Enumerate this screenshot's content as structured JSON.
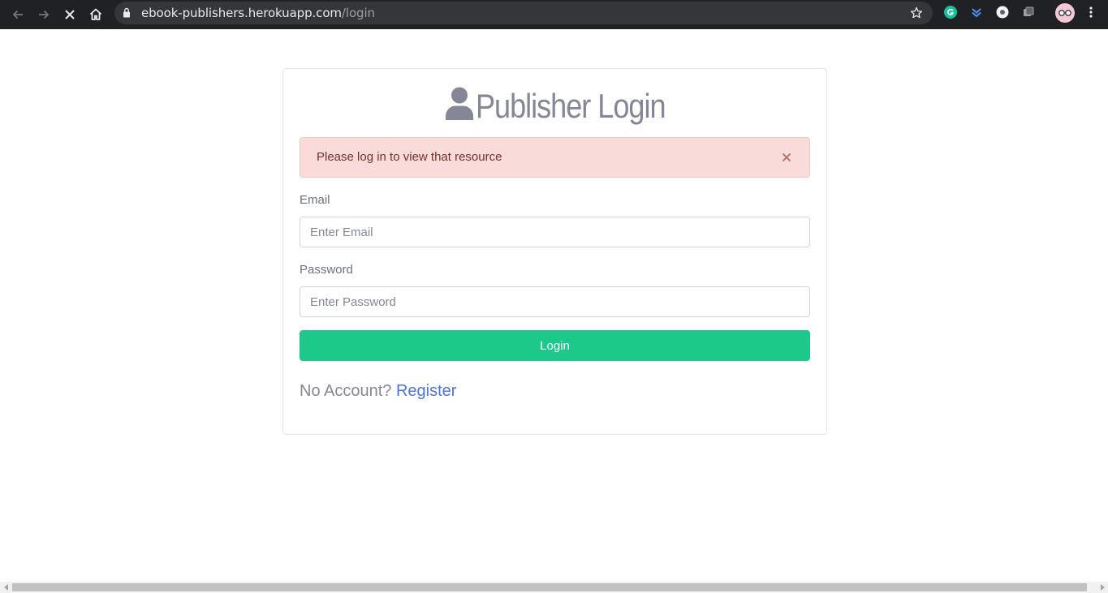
{
  "browser": {
    "url_host": "ebook-publishers.herokuapp.com",
    "url_path": "/login",
    "icons": {
      "back": "arrow-left-icon",
      "forward": "arrow-right-icon",
      "stop": "close-x-icon",
      "home": "home-icon",
      "lock": "lock-icon",
      "bookmark": "star-icon",
      "extensions": [
        "grammarly-icon",
        "pocket-icon",
        "lens-icon",
        "puzzle-icon"
      ],
      "profile": "avatar-icon",
      "menu": "kebab-menu-icon"
    }
  },
  "page": {
    "title": "Publisher Login",
    "title_icon": "user-icon",
    "alert": {
      "message": "Please log in to view that resource",
      "close_symbol": "×"
    },
    "form": {
      "email_label": "Email",
      "email_placeholder": "Enter Email",
      "email_value": "",
      "password_label": "Password",
      "password_placeholder": "Enter Password",
      "password_value": "",
      "submit_label": "Login"
    },
    "footer": {
      "prompt": "No Account?",
      "register_label": "Register"
    }
  },
  "colors": {
    "accent_green": "#1cc88a",
    "link_blue": "#4e73df",
    "alert_bg": "#f9dbd9",
    "alert_text": "#7a2e2a",
    "muted_text": "#858796",
    "toolbar_bg": "#202124"
  }
}
